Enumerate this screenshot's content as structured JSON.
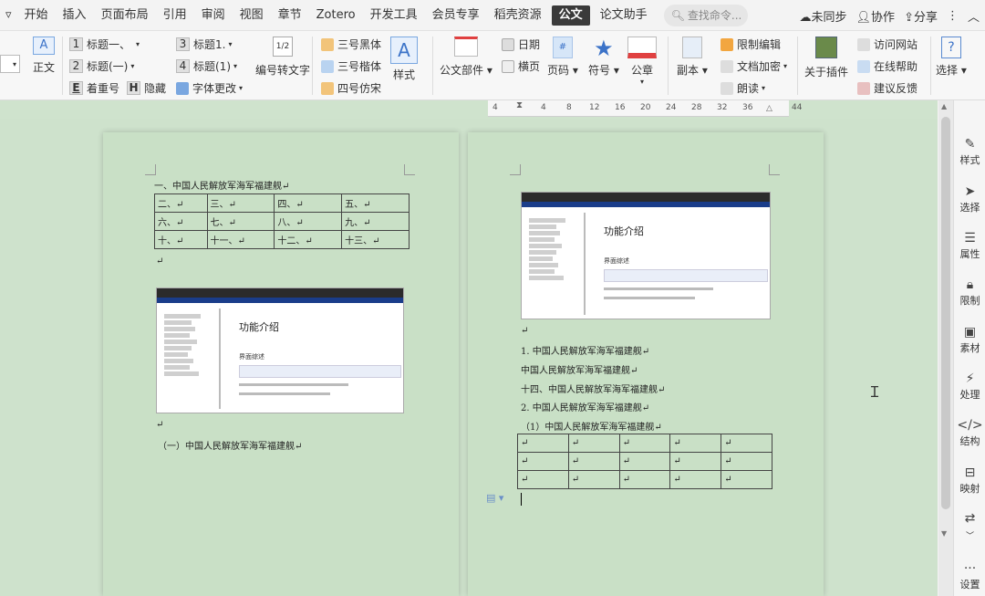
{
  "menubar": {
    "items": [
      "开始",
      "插入",
      "页面布局",
      "引用",
      "审阅",
      "视图",
      "章节",
      "Zotero",
      "开发工具",
      "会员专享",
      "稻壳资源",
      "公文",
      "论文助手"
    ],
    "active": "公文",
    "search_placeholder": "查找命令...",
    "sync": "未同步",
    "collab": "协作",
    "share": "分享"
  },
  "ribbon": {
    "zhengwen": "正文",
    "h1": "标题一、",
    "h2": "标题(一)",
    "emph": "着重号",
    "hide": "隐藏",
    "t3": "标题1.",
    "t4": "标题(1)",
    "fontchange": "字体更改",
    "numconv": "编号转文字",
    "f1": "三号黑体",
    "f2": "三号楷体",
    "f3": "四号仿宋",
    "style": "样式",
    "gongwen_parts": "公文部件",
    "date": "日期",
    "landscape": "横页",
    "pagenum": "页码",
    "symbol": "符号",
    "seal": "公章",
    "copy": "副本",
    "restrict": "限制编辑",
    "encrypt": "文档加密",
    "read": "朗读",
    "about": "关于插件",
    "visit": "访问网站",
    "help": "在线帮助",
    "feedback": "建议反馈",
    "select": "选择",
    "num_h1": "1",
    "num_h2": "2",
    "num_t3": "3",
    "num_t4": "4",
    "bold_h": "H",
    "emph_e": "E",
    "style_a": "A",
    "frac": "1/2",
    "question": "?"
  },
  "ruler": {
    "labels": [
      "4",
      "4",
      "8",
      "12",
      "16",
      "20",
      "24",
      "28",
      "32",
      "36",
      "44"
    ]
  },
  "page1": {
    "heading": "一、中国人民解放军海军福建舰↵",
    "table": [
      [
        "二、↵",
        "三、↵",
        "四、↵",
        "五、↵"
      ],
      [
        "六、↵",
        "七、↵",
        "八、↵",
        "九、↵"
      ],
      [
        "十、↵",
        "十一、↵",
        "十二、↵",
        "十三、↵"
      ]
    ],
    "para_mark": "↵",
    "shot_title": "功能介绍",
    "shot_sub": "界面综述",
    "caption_mark": "↵",
    "sub_heading": "（一）中国人民解放军海军福建舰↵"
  },
  "page2": {
    "shot_title": "功能介绍",
    "shot_sub": "界面综述",
    "para_mark": "↵",
    "lines": [
      "1. 中国人民解放军海军福建舰↵",
      "中国人民解放军海军福建舰↵",
      "十四、中国人民解放军海军福建舰↵",
      "2. 中国人民解放军海军福建舰↵",
      "（1）中国人民解放军海军福建舰↵"
    ],
    "table": [
      [
        "↵",
        "↵",
        "↵",
        "↵",
        "↵"
      ],
      [
        "↵",
        "↵",
        "↵",
        "↵",
        "↵"
      ],
      [
        "↵",
        "↵",
        "↵",
        "↵",
        "↵"
      ]
    ]
  },
  "rightbar": {
    "items": [
      "样式",
      "选择",
      "属性",
      "限制",
      "素材",
      "处理",
      "结构",
      "映射",
      "设置"
    ]
  }
}
